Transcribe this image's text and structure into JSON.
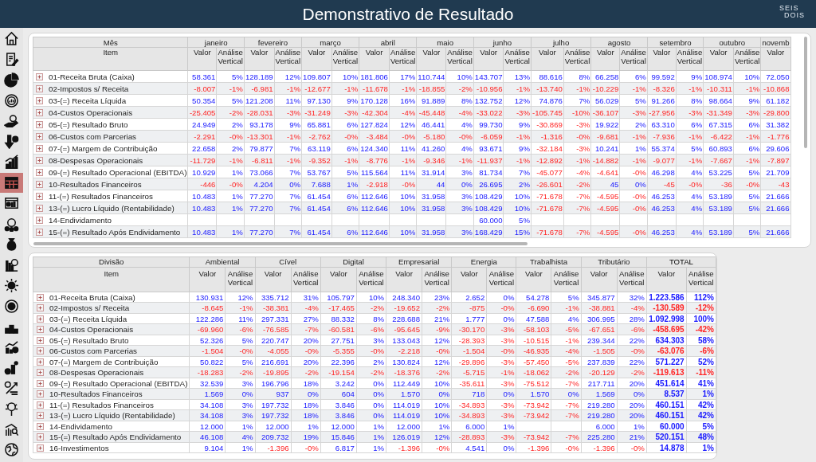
{
  "header": {
    "title": "Demonstrativo de Resultado",
    "logo_top": "SEIS",
    "logo_bottom": "DOIS"
  },
  "sidebar": {
    "items": [
      {
        "selected": false
      },
      {
        "selected": false
      },
      {
        "selected": false
      },
      {
        "selected": false
      },
      {
        "selected": false
      },
      {
        "selected": false
      },
      {
        "selected": false
      },
      {
        "selected": true
      },
      {
        "selected": false
      },
      {
        "selected": false
      },
      {
        "selected": false
      },
      {
        "selected": false
      },
      {
        "selected": false
      },
      {
        "selected": false
      },
      {
        "selected": false
      },
      {
        "selected": false
      },
      {
        "selected": false
      },
      {
        "selected": false
      },
      {
        "selected": false
      },
      {
        "selected": false
      },
      {
        "selected": false
      }
    ]
  },
  "month_table": {
    "corner_label": "Mês",
    "item_header": "Item",
    "groups": [
      {
        "name": "janeiro",
        "value_header": "Valor",
        "av_header": "Análise Vertical",
        "total": false
      },
      {
        "name": "fevereiro",
        "value_header": "Valor",
        "av_header": "Análise Vertical",
        "total": false
      },
      {
        "name": "março",
        "value_header": "Valor",
        "av_header": "Análise Vertical",
        "total": false
      },
      {
        "name": "abril",
        "value_header": "Valor",
        "av_header": "Análise Vertical",
        "total": false
      },
      {
        "name": "maio",
        "value_header": "Valor",
        "av_header": "Análise Vertical",
        "total": false
      },
      {
        "name": "junho",
        "value_header": "Valor",
        "av_header": "Análise Vertical",
        "total": false
      },
      {
        "name": "julho",
        "value_header": "Valor",
        "av_header": "Análise Vertical",
        "total": false
      },
      {
        "name": "agosto",
        "value_header": "Valor",
        "av_header": "Análise Vertical",
        "total": false
      },
      {
        "name": "setembro",
        "value_header": "Valor",
        "av_header": "Análise Vertical",
        "total": false
      },
      {
        "name": "outubro",
        "value_header": "Valor",
        "av_header": "Análise Vertical",
        "total": false
      },
      {
        "name": "novemb",
        "value_header": "Valor"
      }
    ],
    "rows": [
      {
        "item": "01-Receita Bruta (Caixa)",
        "cells": [
          "58.361",
          "5%",
          "128.189",
          "12%",
          "109.807",
          "10%",
          "181.806",
          "17%",
          "110.744",
          "10%",
          "143.707",
          "13%",
          "88.616",
          "8%",
          "66.258",
          "6%",
          "99.592",
          "9%",
          "108.974",
          "10%",
          "72.050"
        ]
      },
      {
        "item": "02-Impostos s/ Receita",
        "cells": [
          "-8.007",
          "-1%",
          "-6.981",
          "-1%",
          "-12.677",
          "-1%",
          "-11.678",
          "-1%",
          "-18.855",
          "-2%",
          "-10.956",
          "-1%",
          "-13.740",
          "-1%",
          "-10.229",
          "-1%",
          "-8.326",
          "-1%",
          "-10.311",
          "-1%",
          "-10.868"
        ]
      },
      {
        "item": "03-(=) Receita Líquida",
        "cells": [
          "50.354",
          "5%",
          "121.208",
          "11%",
          "97.130",
          "9%",
          "170.128",
          "16%",
          "91.889",
          "8%",
          "132.752",
          "12%",
          "74.876",
          "7%",
          "56.029",
          "5%",
          "91.266",
          "8%",
          "98.664",
          "9%",
          "61.182"
        ]
      },
      {
        "item": "04-Custos Operacionais",
        "cells": [
          "-25.405",
          "-2%",
          "-28.031",
          "-3%",
          "-31.249",
          "-3%",
          "-42.304",
          "-4%",
          "-45.448",
          "-4%",
          "-33.022",
          "-3%",
          "-105.745",
          "-10%",
          "-36.107",
          "-3%",
          "-27.956",
          "-3%",
          "-31.349",
          "-3%",
          "-29.800"
        ]
      },
      {
        "item": "05-(=) Resultado Bruto",
        "cells": [
          "24.949",
          "2%",
          "93.178",
          "9%",
          "65.881",
          "6%",
          "127.824",
          "12%",
          "46.441",
          "4%",
          "99.730",
          "9%",
          "-30.869",
          "-3%",
          "19.922",
          "2%",
          "63.310",
          "6%",
          "67.315",
          "6%",
          "31.382"
        ]
      },
      {
        "item": "06-Custos com Parcerias",
        "cells": [
          "-2.291",
          "-0%",
          "-13.301",
          "-1%",
          "-2.762",
          "-0%",
          "-3.484",
          "-0%",
          "-5.180",
          "-0%",
          "-6.059",
          "-1%",
          "-1.316",
          "-0%",
          "-9.681",
          "-1%",
          "-7.936",
          "-1%",
          "-6.422",
          "-1%",
          "-1.776"
        ]
      },
      {
        "item": "07-(=) Margem de Contribuição",
        "cells": [
          "22.658",
          "2%",
          "79.877",
          "7%",
          "63.119",
          "6%",
          "124.340",
          "11%",
          "41.260",
          "4%",
          "93.671",
          "9%",
          "-32.184",
          "-3%",
          "10.241",
          "1%",
          "55.374",
          "5%",
          "60.893",
          "6%",
          "29.606"
        ]
      },
      {
        "item": "08-Despesas Operacionais",
        "cells": [
          "-11.729",
          "-1%",
          "-6.811",
          "-1%",
          "-9.352",
          "-1%",
          "-8.776",
          "-1%",
          "-9.346",
          "-1%",
          "-11.937",
          "-1%",
          "-12.892",
          "-1%",
          "-14.882",
          "-1%",
          "-9.077",
          "-1%",
          "-7.667",
          "-1%",
          "-7.897"
        ]
      },
      {
        "item": "09-(=) Resultado Operacional (EBITDA)",
        "cells": [
          "10.929",
          "1%",
          "73.066",
          "7%",
          "53.767",
          "5%",
          "115.564",
          "11%",
          "31.914",
          "3%",
          "81.734",
          "7%",
          "-45.077",
          "-4%",
          "-4.641",
          "-0%",
          "46.298",
          "4%",
          "53.225",
          "5%",
          "21.709"
        ]
      },
      {
        "item": "10-Resultados Financeiros",
        "cells": [
          "-446",
          "-0%",
          "4.204",
          "0%",
          "7.688",
          "1%",
          "-2.918",
          "-0%",
          "44",
          "0%",
          "26.695",
          "2%",
          "-26.601",
          "-2%",
          "45",
          "0%",
          "-45",
          "-0%",
          "-36",
          "-0%",
          "-43"
        ]
      },
      {
        "item": "11-(=) Resultados Financeiros",
        "cells": [
          "10.483",
          "1%",
          "77.270",
          "7%",
          "61.454",
          "6%",
          "112.646",
          "10%",
          "31.958",
          "3%",
          "108.429",
          "10%",
          "-71.678",
          "-7%",
          "-4.595",
          "-0%",
          "46.253",
          "4%",
          "53.189",
          "5%",
          "21.666"
        ]
      },
      {
        "item": "13-(=) Lucro Líquido (Rentabilidade)",
        "cells": [
          "10.483",
          "1%",
          "77.270",
          "7%",
          "61.454",
          "6%",
          "112.646",
          "10%",
          "31.958",
          "3%",
          "108.429",
          "10%",
          "-71.678",
          "-7%",
          "-4.595",
          "-0%",
          "46.253",
          "4%",
          "53.189",
          "5%",
          "21.666"
        ]
      },
      {
        "item": "14-Endividamento",
        "cells": [
          null,
          null,
          null,
          null,
          null,
          null,
          null,
          null,
          null,
          null,
          "60.000",
          "5%",
          null,
          null,
          null,
          null,
          null,
          null,
          null,
          null,
          null
        ]
      },
      {
        "item": "15-(=) Resultado Após Endividamento",
        "cells": [
          "10.483",
          "1%",
          "77.270",
          "7%",
          "61.454",
          "6%",
          "112.646",
          "10%",
          "31.958",
          "3%",
          "168.429",
          "15%",
          "-71.678",
          "-7%",
          "-4.595",
          "-0%",
          "46.253",
          "4%",
          "53.189",
          "5%",
          "21.666"
        ]
      }
    ]
  },
  "division_table": {
    "corner_label": "Divisão",
    "item_header": "Item",
    "groups": [
      {
        "name": "Ambiental",
        "value_header": "Valor",
        "av_header": "Análise Vertical",
        "total": false
      },
      {
        "name": "Cível",
        "value_header": "Valor",
        "av_header": "Análise Vertical",
        "total": false
      },
      {
        "name": "Digital",
        "value_header": "Valor",
        "av_header": "Análise Vertical",
        "total": false
      },
      {
        "name": "Empresarial",
        "value_header": "Valor",
        "av_header": "Análise Vertical",
        "total": false
      },
      {
        "name": "Energia",
        "value_header": "Valor",
        "av_header": "Análise Vertical",
        "total": false
      },
      {
        "name": "Trabalhista",
        "value_header": "Valor",
        "av_header": "Análise Vertical",
        "total": false
      },
      {
        "name": "Tributário",
        "value_header": "Valor",
        "av_header": "Análise Vertical",
        "total": false
      },
      {
        "name": "TOTAL",
        "value_header": "Valor",
        "av_header": "Análise Vertical",
        "total": true
      }
    ],
    "rows": [
      {
        "item": "01-Receita Bruta (Caixa)",
        "cells": [
          "130.931",
          "12%",
          "335.712",
          "31%",
          "105.797",
          "10%",
          "248.340",
          "23%",
          "2.652",
          "0%",
          "54.278",
          "5%",
          "345.877",
          "32%",
          "1.223.586",
          "112%"
        ]
      },
      {
        "item": "02-Impostos s/ Receita",
        "cells": [
          "-8.645",
          "-1%",
          "-38.381",
          "-4%",
          "-17.465",
          "-2%",
          "-19.652",
          "-2%",
          "-875",
          "-0%",
          "-6.690",
          "-1%",
          "-38.881",
          "-4%",
          "-130.589",
          "-12%"
        ]
      },
      {
        "item": "03-(=) Receita Líquida",
        "cells": [
          "122.286",
          "11%",
          "297.331",
          "27%",
          "88.332",
          "8%",
          "228.688",
          "21%",
          "1.777",
          "0%",
          "47.588",
          "4%",
          "306.995",
          "28%",
          "1.092.998",
          "100%"
        ]
      },
      {
        "item": "04-Custos Operacionais",
        "cells": [
          "-69.960",
          "-6%",
          "-76.585",
          "-7%",
          "-60.581",
          "-6%",
          "-95.645",
          "-9%",
          "-30.170",
          "-3%",
          "-58.103",
          "-5%",
          "-67.651",
          "-6%",
          "-458.695",
          "-42%"
        ]
      },
      {
        "item": "05-(=) Resultado Bruto",
        "cells": [
          "52.326",
          "5%",
          "220.747",
          "20%",
          "27.751",
          "3%",
          "133.043",
          "12%",
          "-28.393",
          "-3%",
          "-10.515",
          "-1%",
          "239.344",
          "22%",
          "634.303",
          "58%"
        ]
      },
      {
        "item": "06-Custos com Parcerias",
        "cells": [
          "-1.504",
          "-0%",
          "-4.055",
          "-0%",
          "-5.355",
          "-0%",
          "-2.218",
          "-0%",
          "-1.504",
          "-0%",
          "-46.935",
          "-4%",
          "-1.505",
          "-0%",
          "-63.076",
          "-6%"
        ]
      },
      {
        "item": "07-(=) Margem de Contribuição",
        "cells": [
          "50.822",
          "5%",
          "216.691",
          "20%",
          "22.396",
          "2%",
          "130.824",
          "12%",
          "-29.896",
          "-3%",
          "-57.450",
          "-5%",
          "237.839",
          "22%",
          "571.227",
          "52%"
        ]
      },
      {
        "item": "08-Despesas Operacionais",
        "cells": [
          "-18.283",
          "-2%",
          "-19.895",
          "-2%",
          "-19.154",
          "-2%",
          "-18.376",
          "-2%",
          "-5.715",
          "-1%",
          "-18.062",
          "-2%",
          "-20.129",
          "-2%",
          "-119.613",
          "-11%"
        ]
      },
      {
        "item": "09-(=) Resultado Operacional (EBITDA)",
        "cells": [
          "32.539",
          "3%",
          "196.796",
          "18%",
          "3.242",
          "0%",
          "112.449",
          "10%",
          "-35.611",
          "-3%",
          "-75.512",
          "-7%",
          "217.711",
          "20%",
          "451.614",
          "41%"
        ]
      },
      {
        "item": "10-Resultados Financeiros",
        "cells": [
          "1.569",
          "0%",
          "937",
          "0%",
          "604",
          "0%",
          "1.570",
          "0%",
          "718",
          "0%",
          "1.570",
          "0%",
          "1.569",
          "0%",
          "8.537",
          "1%"
        ]
      },
      {
        "item": "11-(=) Resultados Financeiros",
        "cells": [
          "34.108",
          "3%",
          "197.732",
          "18%",
          "3.846",
          "0%",
          "114.019",
          "10%",
          "-34.893",
          "-3%",
          "-73.942",
          "-7%",
          "219.280",
          "20%",
          "460.151",
          "42%"
        ]
      },
      {
        "item": "13-(=) Lucro Líquido (Rentabilidade)",
        "cells": [
          "34.108",
          "3%",
          "197.732",
          "18%",
          "3.846",
          "0%",
          "114.019",
          "10%",
          "-34.893",
          "-3%",
          "-73.942",
          "-7%",
          "219.280",
          "20%",
          "460.151",
          "42%"
        ]
      },
      {
        "item": "14-Endividamento",
        "cells": [
          "12.000",
          "1%",
          "12.000",
          "1%",
          "12.000",
          "1%",
          "12.000",
          "1%",
          "6.000",
          "1%",
          null,
          null,
          "6.000",
          "1%",
          "60.000",
          "5%"
        ]
      },
      {
        "item": "15-(=) Resultado Após Endividamento",
        "cells": [
          "46.108",
          "4%",
          "209.732",
          "19%",
          "15.846",
          "1%",
          "126.019",
          "12%",
          "-28.893",
          "-3%",
          "-73.942",
          "-7%",
          "225.280",
          "21%",
          "520.151",
          "48%"
        ]
      },
      {
        "item": "16-Investimentos",
        "cells": [
          "9.104",
          "1%",
          "-1.396",
          "-0%",
          "6.817",
          "1%",
          "-1.396",
          "-0%",
          "4.541",
          "0%",
          "-1.396",
          "-0%",
          "-1.396",
          "-0%",
          "14.878",
          "1%"
        ]
      }
    ]
  }
}
